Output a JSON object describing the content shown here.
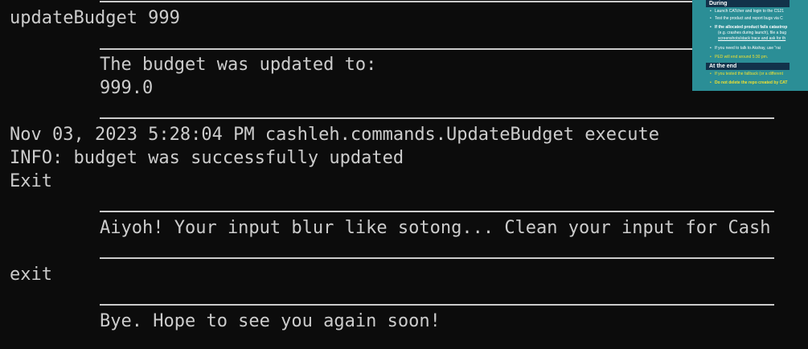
{
  "terminal": {
    "lines": {
      "cmd_update": "updateBudget 999",
      "budget_msg": "The budget was updated to:",
      "budget_value": "999.0",
      "log_timestamp": "Nov 03, 2023 5:28:04 PM cashleh.commands.UpdateBudget execute",
      "log_info": "INFO: budget was successfully updated",
      "exit_cap": "Exit",
      "error_msg": "Aiyoh! Your input blur like sotong... Clean your input for Cash",
      "cmd_exit": "exit",
      "bye_msg": "Bye. Hope to see you again soon!"
    }
  },
  "thumbnail": {
    "during_header": "During",
    "during_items": [
      "Launch CATcher and login to the CS21",
      "Test the product and report bugs via C",
      "If the allocated product fails catastrop",
      "(e.g. crashes during launch), file a bug",
      "screenshots/stack trace and ask for th",
      "If you need to talk to Akshay, use \"rai",
      "PED will end around 5:30 pm."
    ],
    "end_header": "At the end",
    "end_items": [
      "If you tested the fallback (or a different",
      "Do not delete the repo created by CAT"
    ]
  }
}
